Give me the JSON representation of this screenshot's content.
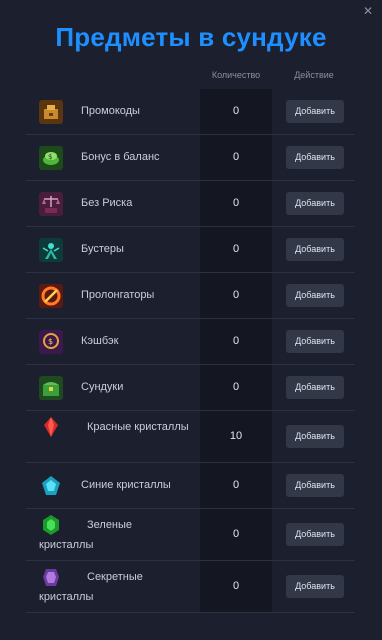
{
  "modal": {
    "title": "Предметы в сундуке",
    "close_icon": "close-icon",
    "columns": {
      "quantity": "Количество",
      "action": "Действие"
    }
  },
  "items": [
    {
      "name": "Промокоды",
      "quantity": "0",
      "button": "Добавить",
      "icon": "promo-icon"
    },
    {
      "name": "Бонус в баланс",
      "quantity": "0",
      "button": "Добавить",
      "icon": "bonus-balance-icon"
    },
    {
      "name": "Без Риска",
      "quantity": "0",
      "button": "Добавить",
      "icon": "no-risk-icon"
    },
    {
      "name": "Бустеры",
      "quantity": "0",
      "button": "Добавить",
      "icon": "booster-icon"
    },
    {
      "name": "Пролонгаторы",
      "quantity": "0",
      "button": "Добавить",
      "icon": "prolongator-icon"
    },
    {
      "name": "Кэшбэк",
      "quantity": "0",
      "button": "Добавить",
      "icon": "cashback-icon"
    },
    {
      "name": "Сундуки",
      "quantity": "0",
      "button": "Добавить",
      "icon": "chest-icon"
    },
    {
      "name": "Красные кристаллы",
      "quantity": "10",
      "button": "Добавить",
      "icon": "red-crystal-icon"
    },
    {
      "name": "Синие кристаллы",
      "quantity": "0",
      "button": "Добавить",
      "icon": "blue-crystal-icon"
    },
    {
      "name": "Зеленые кристаллы",
      "quantity": "0",
      "button": "Добавить",
      "icon": "green-crystal-icon"
    },
    {
      "name": "Секретные кристаллы",
      "quantity": "0",
      "button": "Добавить",
      "icon": "secret-crystal-icon"
    }
  ],
  "colors": {
    "title": "#1e8fff",
    "background": "#1c1f2e",
    "button": "#323848"
  }
}
